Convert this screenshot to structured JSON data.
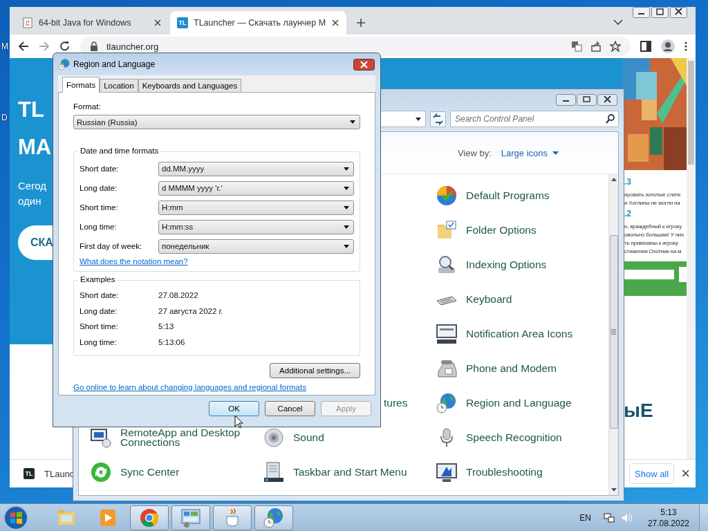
{
  "desktop": {
    "icon_labels": [
      "M",
      "D"
    ]
  },
  "browser": {
    "tabs": [
      {
        "title": "64-bit Java for Windows",
        "selected": false
      },
      {
        "title": "TLauncher — Скачать лаунчер М",
        "icon_text": "TL",
        "selected": true
      }
    ],
    "address": "tlauncher.org",
    "page": {
      "hero_title": [
        "TL",
        "МА"
      ],
      "hero_text": [
        "Сегод",
        "один"
      ],
      "hero_button": "СКА",
      "news": [
        {
          "kind": "heading",
          "text": ".3"
        },
        {
          "kind": "line",
          "text": "ировать золотые слитк"
        },
        {
          "kind": "line",
          "text": "и Хоглины не могли на"
        },
        {
          "kind": "heading",
          "text": ".2"
        },
        {
          "kind": "line",
          "text": "н, враждебный к игроку"
        },
        {
          "kind": "line",
          "text": "овольно большая! У них"
        },
        {
          "kind": "line",
          "text": "ть привязаны к игроку"
        },
        {
          "kind": "line",
          "text": "стижения Охотник на м"
        }
      ],
      "banner_text": "ыЕ"
    },
    "download_bar": {
      "icon_text": "TL",
      "file": "TLaunc",
      "show_all": "Show all",
      "close": "×"
    }
  },
  "control_panel": {
    "search_placeholder": "Search Control Panel",
    "view_by_label": "View by:",
    "view_by_value": "Large icons",
    "rows": [
      {
        "cells": [
          null,
          null,
          {
            "label": "Default Programs"
          }
        ]
      },
      {
        "cells": [
          null,
          null,
          {
            "label": "Folder Options"
          }
        ]
      },
      {
        "cells": [
          null,
          null,
          {
            "label": "Indexing Options"
          }
        ]
      },
      {
        "cells": [
          null,
          null,
          {
            "label": "Keyboard"
          }
        ]
      },
      {
        "cells": [
          null,
          null,
          {
            "label": "Notification Area Icons"
          }
        ]
      },
      {
        "cells": [
          null,
          null,
          {
            "label": "Phone and Modem"
          }
        ]
      },
      {
        "cells": [
          null,
          {
            "label": "tures"
          },
          {
            "label": "Region and Language"
          }
        ]
      },
      {
        "cells": [
          {
            "label": "RemoteApp and Desktop Connections"
          },
          {
            "label": "Sound"
          },
          {
            "label": "Speech Recognition"
          }
        ]
      },
      {
        "cells": [
          {
            "label": "Sync Center"
          },
          {
            "label": "Taskbar and Start Menu"
          },
          {
            "label": "Troubleshooting"
          }
        ]
      }
    ]
  },
  "dialog": {
    "title": "Region and Language",
    "tabs": [
      {
        "label": "Formats",
        "selected": true
      },
      {
        "label": "Location",
        "selected": false
      },
      {
        "label": "Keyboards and Languages",
        "selected": false
      }
    ],
    "format_label": "Format:",
    "format_value": "Russian (Russia)",
    "formats_group": "Date and time formats",
    "formats": [
      {
        "label": "Short date:",
        "value": "dd.MM.yyyy"
      },
      {
        "label": "Long date:",
        "value": "d MMMM yyyy 'г.'"
      },
      {
        "label": "Short time:",
        "value": "H:mm"
      },
      {
        "label": "Long time:",
        "value": "H:mm:ss"
      },
      {
        "label": "First day of week:",
        "value": "понедельник"
      }
    ],
    "notation_link": "What does the notation mean?",
    "examples_group": "Examples",
    "examples": [
      {
        "label": "Short date:",
        "value": "27.08.2022"
      },
      {
        "label": "Long date:",
        "value": "27 августа 2022 г."
      },
      {
        "label": "Short time:",
        "value": "5:13"
      },
      {
        "label": "Long time:",
        "value": "5:13:06"
      }
    ],
    "additional_button": "Additional settings...",
    "online_link": "Go online to learn about changing languages and regional formats",
    "buttons": [
      {
        "label": "OK",
        "default": true,
        "disabled": false
      },
      {
        "label": "Cancel",
        "default": false,
        "disabled": false
      },
      {
        "label": "Apply",
        "default": false,
        "disabled": true
      }
    ]
  },
  "taskbar": {
    "buttons": [
      {
        "running": false
      },
      {
        "running": false
      },
      {
        "running": true
      },
      {
        "running": true
      },
      {
        "running": true
      },
      {
        "running": true
      }
    ],
    "language": "EN",
    "time": "5:13",
    "date": "27.08.2022"
  }
}
